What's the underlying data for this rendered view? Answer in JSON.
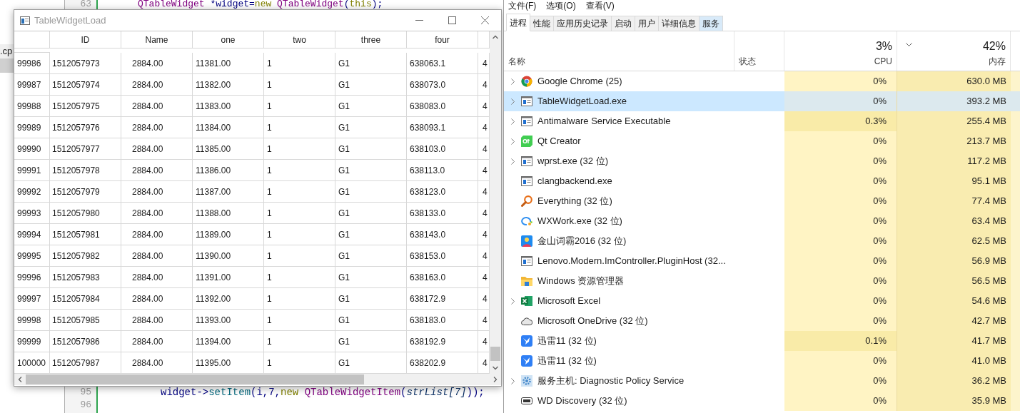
{
  "editor": {
    "side_tab": ".cp",
    "lines": [
      {
        "number": "63",
        "tokens": [
          {
            "kind": "type",
            "text": "QTableWidget"
          },
          {
            "kind": "plain",
            "text": " *widget="
          },
          {
            "kind": "keyword",
            "text": "new"
          },
          {
            "kind": "type",
            "text": " QTableWidget"
          },
          {
            "kind": "plain",
            "text": "("
          },
          {
            "kind": "keyword",
            "text": "this"
          },
          {
            "kind": "plain",
            "text": ");"
          }
        ]
      },
      {
        "number": "95",
        "tokens": [
          {
            "kind": "plain",
            "text": "widget->"
          },
          {
            "kind": "func",
            "text": "setItem"
          },
          {
            "kind": "plain",
            "text": "(i,7,"
          },
          {
            "kind": "keyword",
            "text": "new"
          },
          {
            "kind": "type",
            "text": " QTableWidgetItem"
          },
          {
            "kind": "plain",
            "text": "("
          },
          {
            "kind": "param",
            "text": "strList[7]"
          },
          {
            "kind": "plain",
            "text": "));"
          }
        ]
      },
      {
        "number": "96"
      }
    ]
  },
  "table_window": {
    "title": "TableWidgetLoad",
    "columns": [
      "ID",
      "Name",
      "one",
      "two",
      "three",
      "four"
    ],
    "rows": [
      {
        "header": "99986",
        "cells": [
          "1512057973",
          "2884.00",
          "11381.00",
          "1",
          "G1",
          "638063.1",
          "4"
        ]
      },
      {
        "header": "99987",
        "cells": [
          "1512057974",
          "2884.00",
          "11382.00",
          "1",
          "G1",
          "638073.0",
          "4"
        ]
      },
      {
        "header": "99988",
        "cells": [
          "1512057975",
          "2884.00",
          "11383.00",
          "1",
          "G1",
          "638083.0",
          "4"
        ]
      },
      {
        "header": "99989",
        "cells": [
          "1512057976",
          "2884.00",
          "11384.00",
          "1",
          "G1",
          "638093.1",
          "4"
        ]
      },
      {
        "header": "99990",
        "cells": [
          "1512057977",
          "2884.00",
          "11385.00",
          "1",
          "G1",
          "638103.0",
          "4"
        ]
      },
      {
        "header": "99991",
        "cells": [
          "1512057978",
          "2884.00",
          "11386.00",
          "1",
          "G1",
          "638113.0",
          "4"
        ]
      },
      {
        "header": "99992",
        "cells": [
          "1512057979",
          "2884.00",
          "11387.00",
          "1",
          "G1",
          "638123.0",
          "4"
        ]
      },
      {
        "header": "99993",
        "cells": [
          "1512057980",
          "2884.00",
          "11388.00",
          "1",
          "G1",
          "638133.0",
          "4"
        ]
      },
      {
        "header": "99994",
        "cells": [
          "1512057981",
          "2884.00",
          "11389.00",
          "1",
          "G1",
          "638143.0",
          "4"
        ]
      },
      {
        "header": "99995",
        "cells": [
          "1512057982",
          "2884.00",
          "11390.00",
          "1",
          "G1",
          "638153.0",
          "4"
        ]
      },
      {
        "header": "99996",
        "cells": [
          "1512057983",
          "2884.00",
          "11391.00",
          "1",
          "G1",
          "638163.0",
          "4"
        ]
      },
      {
        "header": "99997",
        "cells": [
          "1512057984",
          "2884.00",
          "11392.00",
          "1",
          "G1",
          "638172.9",
          "4"
        ]
      },
      {
        "header": "99998",
        "cells": [
          "1512057985",
          "2884.00",
          "11393.00",
          "1",
          "G1",
          "638183.0",
          "4"
        ]
      },
      {
        "header": "99999",
        "cells": [
          "1512057986",
          "2884.00",
          "11394.00",
          "1",
          "G1",
          "638192.9",
          "4"
        ]
      },
      {
        "header": "100000",
        "cells": [
          "1512057987",
          "2884.00",
          "11395.00",
          "1",
          "G1",
          "638202.9",
          "4"
        ]
      }
    ]
  },
  "task_manager": {
    "menu": [
      "文件(F)",
      "选项(O)",
      "查看(V)"
    ],
    "tabs": [
      {
        "label": "进程",
        "selected": true,
        "hover": false
      },
      {
        "label": "性能",
        "selected": false,
        "hover": false
      },
      {
        "label": "应用历史记录",
        "selected": false,
        "hover": false
      },
      {
        "label": "启动",
        "selected": false,
        "hover": false
      },
      {
        "label": "用户",
        "selected": false,
        "hover": false
      },
      {
        "label": "详细信息",
        "selected": false,
        "hover": false
      },
      {
        "label": "服务",
        "selected": false,
        "hover": true
      }
    ],
    "columns": {
      "name": "名称",
      "status": "状态",
      "cpu_total": "3%",
      "cpu": "CPU",
      "memory_total": "42%",
      "memory": "内存"
    },
    "processes": [
      {
        "kind": "chrome",
        "name": "Google Chrome (25)",
        "expandable": true,
        "selected": false,
        "cpu": "0%",
        "cpu_busy": false,
        "memory": "630.0 MB"
      },
      {
        "kind": "app",
        "name": "TableWidgetLoad.exe",
        "expandable": true,
        "selected": true,
        "cpu": "0%",
        "cpu_busy": false,
        "memory": "393.2 MB"
      },
      {
        "kind": "app",
        "name": "Antimalware Service Executable",
        "expandable": true,
        "selected": false,
        "cpu": "0.3%",
        "cpu_busy": true,
        "memory": "255.4 MB"
      },
      {
        "kind": "qt",
        "name": "Qt Creator",
        "expandable": true,
        "selected": false,
        "cpu": "0%",
        "cpu_busy": false,
        "memory": "213.7 MB"
      },
      {
        "kind": "app",
        "name": "wprst.exe (32 位)",
        "expandable": true,
        "selected": false,
        "cpu": "0%",
        "cpu_busy": false,
        "memory": "117.2 MB"
      },
      {
        "kind": "app",
        "name": "clangbackend.exe",
        "expandable": false,
        "selected": false,
        "cpu": "0%",
        "cpu_busy": false,
        "memory": "95.1 MB"
      },
      {
        "kind": "magnifier",
        "name": "Everything (32 位)",
        "expandable": false,
        "selected": false,
        "cpu": "0%",
        "cpu_busy": false,
        "memory": "77.4 MB"
      },
      {
        "kind": "chat",
        "name": "WXWork.exe (32 位)",
        "expandable": false,
        "selected": false,
        "cpu": "0%",
        "cpu_busy": false,
        "memory": "63.4 MB"
      },
      {
        "kind": "person",
        "name": "金山词霸2016 (32 位)",
        "expandable": false,
        "selected": false,
        "cpu": "0%",
        "cpu_busy": false,
        "memory": "62.5 MB"
      },
      {
        "kind": "app",
        "name": "Lenovo.Modern.ImController.PluginHost (32...",
        "expandable": false,
        "selected": false,
        "cpu": "0%",
        "cpu_busy": false,
        "memory": "56.9 MB"
      },
      {
        "kind": "folder",
        "name": "Windows 资源管理器",
        "expandable": false,
        "selected": false,
        "cpu": "0%",
        "cpu_busy": false,
        "memory": "56.5 MB"
      },
      {
        "kind": "excel",
        "name": "Microsoft Excel",
        "expandable": true,
        "selected": false,
        "cpu": "0%",
        "cpu_busy": false,
        "memory": "54.6 MB"
      },
      {
        "kind": "cloud",
        "name": "Microsoft OneDrive (32 位)",
        "expandable": false,
        "selected": false,
        "cpu": "0%",
        "cpu_busy": false,
        "memory": "42.7 MB"
      },
      {
        "kind": "bird",
        "name": "迅雷11 (32 位)",
        "expandable": false,
        "selected": false,
        "cpu": "0.1%",
        "cpu_busy": true,
        "memory": "41.7 MB"
      },
      {
        "kind": "bird",
        "name": "迅雷11 (32 位)",
        "expandable": false,
        "selected": false,
        "cpu": "0%",
        "cpu_busy": false,
        "memory": "41.0 MB"
      },
      {
        "kind": "gear",
        "name": "服务主机: Diagnostic Policy Service",
        "expandable": true,
        "selected": false,
        "cpu": "0%",
        "cpu_busy": false,
        "memory": "36.2 MB"
      },
      {
        "kind": "drive",
        "name": "WD Discovery (32 位)",
        "expandable": false,
        "selected": false,
        "cpu": "0%",
        "cpu_busy": false,
        "memory": "35.9 MB"
      }
    ]
  }
}
